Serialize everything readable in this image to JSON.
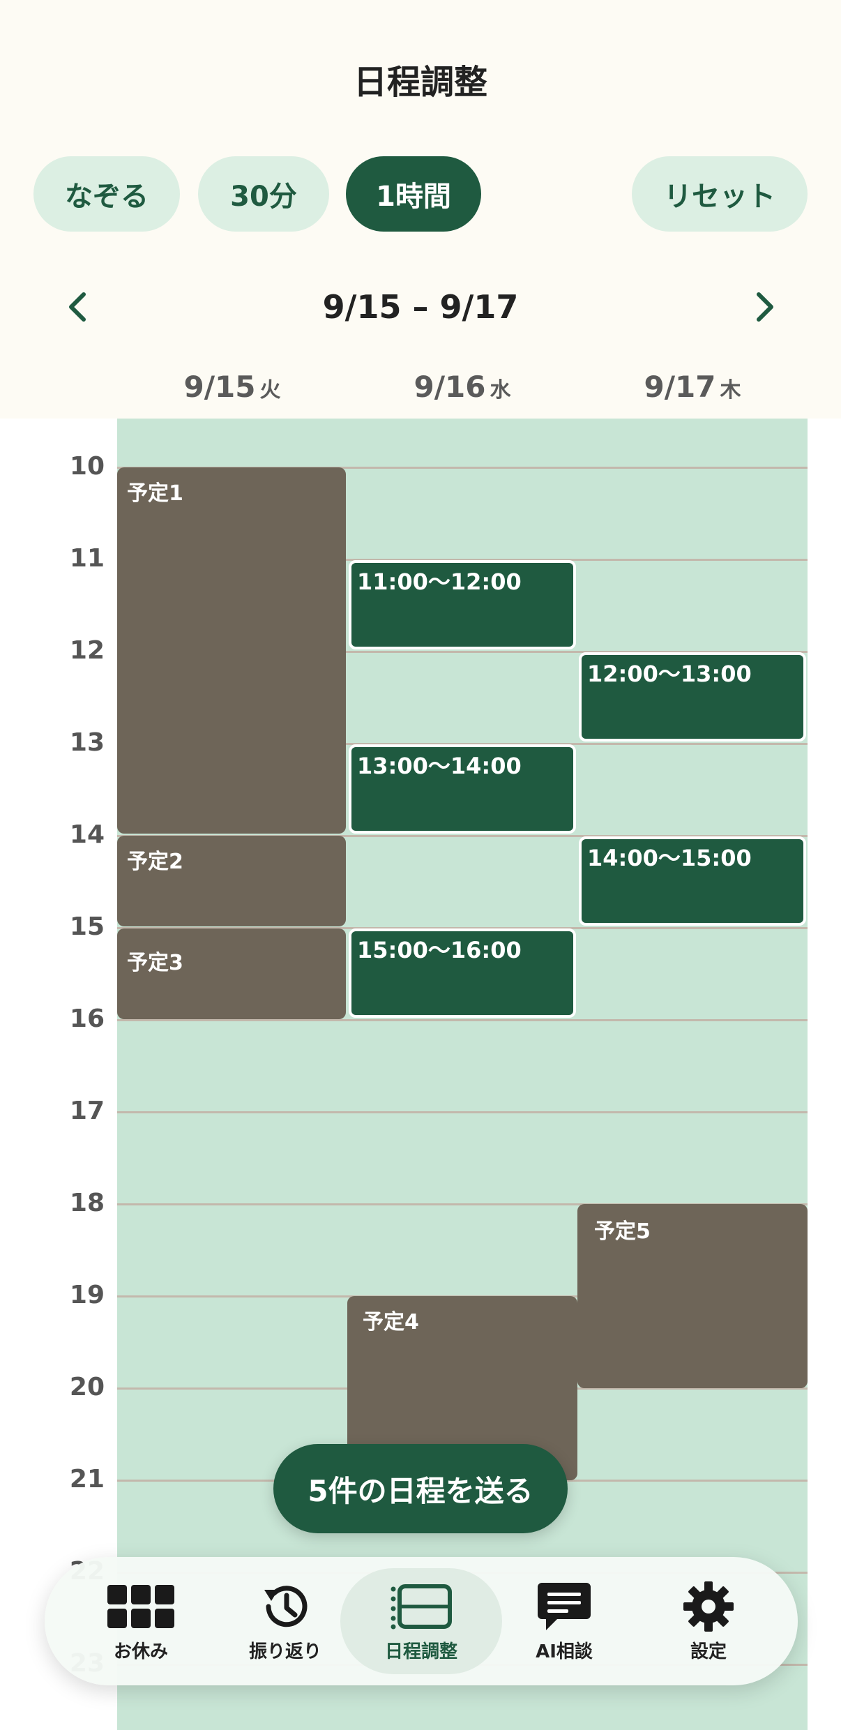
{
  "header": {
    "title": "日程調整",
    "range": "9/15 – 9/17"
  },
  "modes": [
    {
      "label": "なぞる",
      "active": false
    },
    {
      "label": "30分",
      "active": false
    },
    {
      "label": "1時間",
      "active": true
    }
  ],
  "reset_label": "リセット",
  "days": [
    {
      "date": "9/15",
      "weekday": "火"
    },
    {
      "date": "9/16",
      "weekday": "水"
    },
    {
      "date": "9/17",
      "weekday": "木"
    }
  ],
  "hours": [
    "10",
    "11",
    "12",
    "13",
    "14",
    "15",
    "16",
    "17",
    "18",
    "19",
    "20",
    "21",
    "22",
    "23"
  ],
  "busy_events": [
    {
      "label": "予定1",
      "day": "9/15",
      "start": "10:00",
      "end": "14:00"
    },
    {
      "label": "予定2",
      "day": "9/15",
      "start": "14:00",
      "end": "15:00"
    },
    {
      "label": "予定3",
      "day": "9/15",
      "start": "15:00",
      "end": "16:00"
    },
    {
      "label": "予定4",
      "day": "9/16",
      "start": "19:00",
      "end": "21:00"
    },
    {
      "label": "予定5",
      "day": "9/17",
      "start": "18:00",
      "end": "20:00"
    }
  ],
  "selected_slots": [
    {
      "label": "11:00～12:00",
      "day": "9/16"
    },
    {
      "label": "12:00～13:00",
      "day": "9/17"
    },
    {
      "label": "13:00～14:00",
      "day": "9/16"
    },
    {
      "label": "14:00～15:00",
      "day": "9/17"
    },
    {
      "label": "15:00～16:00",
      "day": "9/16"
    }
  ],
  "send_button": "5件の日程を送る",
  "tabs": [
    {
      "label": "お休み",
      "icon": "grid-icon",
      "active": false
    },
    {
      "label": "振り返り",
      "icon": "history-icon",
      "active": false
    },
    {
      "label": "日程調整",
      "icon": "schedule-icon",
      "active": true
    },
    {
      "label": "AI相談",
      "icon": "chat-icon",
      "active": false
    },
    {
      "label": "設定",
      "icon": "gear-icon",
      "active": false
    }
  ],
  "colors": {
    "accent": "#1f5a40",
    "grid": "#c8e5d5",
    "busy": "#6e6558",
    "pill": "#dcefe3",
    "background": "#fdfbf4"
  }
}
